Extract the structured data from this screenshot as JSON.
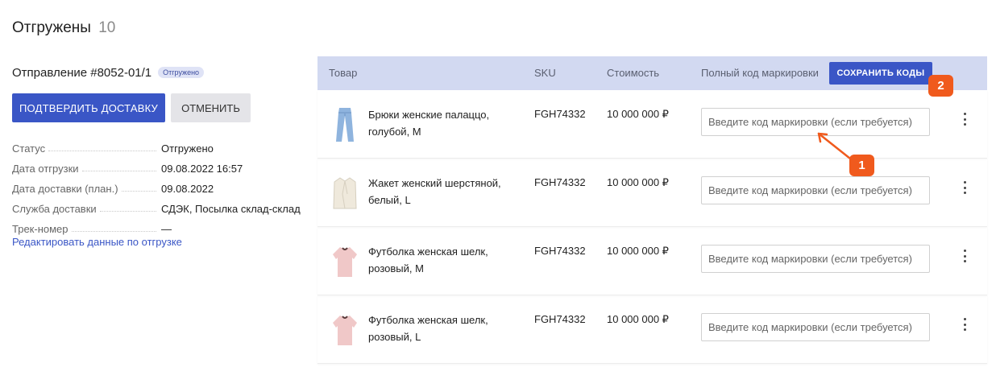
{
  "header": {
    "title": "Отгружены",
    "count": "10"
  },
  "shipment": {
    "title": "Отправление #8052-01/1",
    "badge": "Отгружено",
    "confirm_label": "ПОДТВЕРДИТЬ ДОСТАВКУ",
    "cancel_label": "ОТМЕНИТЬ",
    "info": [
      {
        "label": "Статус",
        "value": "Отгружено"
      },
      {
        "label": "Дата отгрузки",
        "value": "09.08.2022 16:57"
      },
      {
        "label": "Дата доставки (план.)",
        "value": "09.08.2022"
      },
      {
        "label": "Служба доставки",
        "value": "СДЭК, Посылка склад-склад"
      },
      {
        "label": "Трек-номер",
        "value": "—"
      }
    ],
    "edit_link": "Редактировать данные по отгрузке"
  },
  "table": {
    "columns": {
      "product": "Товар",
      "sku": "SKU",
      "price": "Стоимость",
      "code": "Полный код маркировки"
    },
    "save_label": "СОХРАНИТЬ КОДЫ",
    "code_placeholder": "Введите код маркировки (если требуется)",
    "rows": [
      {
        "name": "Брюки женские палаццо, голубой, M",
        "sku": "FGH74332",
        "price": "10 000 000 ₽",
        "icon": "jeans-icon"
      },
      {
        "name": "Жакет женский шерстяной, белый, L",
        "sku": "FGH74332",
        "price": "10 000 000 ₽",
        "icon": "jacket-icon"
      },
      {
        "name": "Футболка женская шелк, розовый, M",
        "sku": "FGH74332",
        "price": "10 000 000 ₽",
        "icon": "tshirt-icon"
      },
      {
        "name": "Футболка женская шелк, розовый, L",
        "sku": "FGH74332",
        "price": "10 000 000 ₽",
        "icon": "tshirt-icon"
      }
    ]
  },
  "annotations": {
    "marker_1": "1",
    "marker_2": "2",
    "color": "#f05a1d"
  },
  "colors": {
    "accent": "#3a56c6",
    "header_bg": "#d2d9f1",
    "badge_bg": "#dfe3f6"
  }
}
